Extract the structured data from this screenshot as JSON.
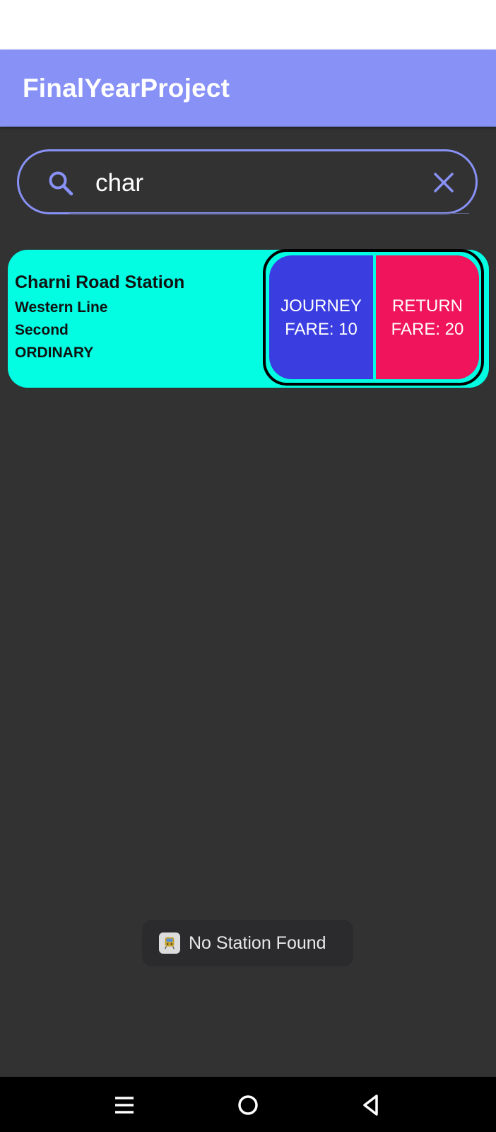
{
  "app_bar": {
    "title": "FinalYearProject"
  },
  "search": {
    "query": "char"
  },
  "results": [
    {
      "station_name": "Charni Road Station",
      "line": "Western Line",
      "class": "Second",
      "ticket_type": "ORDINARY",
      "journey_fare_label": "JOURNEY",
      "journey_fare_value": "FARE: 10",
      "return_fare_label": "RETURN",
      "return_fare_value": "FARE: 20"
    }
  ],
  "toast": {
    "icon": "train-icon",
    "message": "No Station Found"
  },
  "nav_bar": {
    "icons": [
      "recents-icon",
      "home-icon",
      "back-icon"
    ]
  },
  "colors": {
    "accent": "#8891f5",
    "background": "#323232",
    "card": "#02fde2",
    "journey": "#3a3de0",
    "return": "#f0145d"
  }
}
